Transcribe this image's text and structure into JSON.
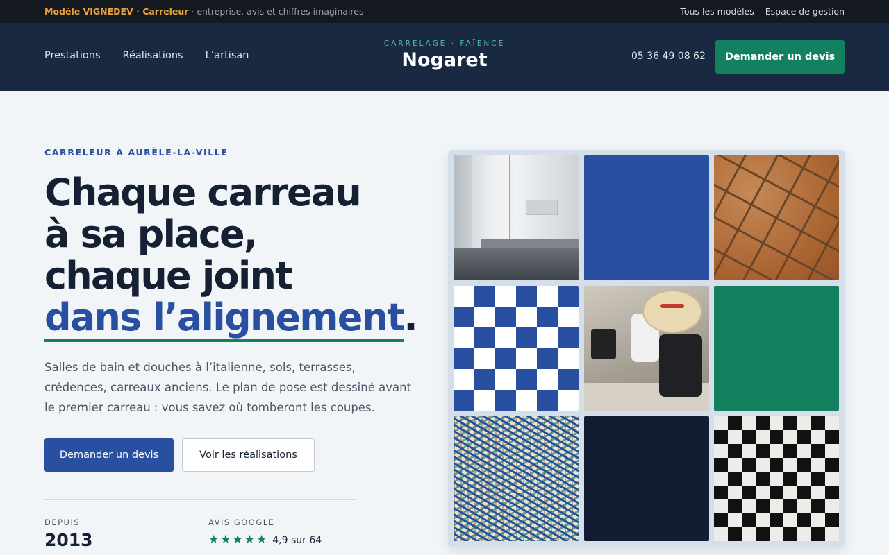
{
  "topstrip": {
    "brand": "Modèle VIGNEDEV · Carreleur",
    "tagline": " · entreprise, avis et chiffres imaginaires",
    "links": [
      "Tous les modèles",
      "Espace de gestion"
    ]
  },
  "header": {
    "nav": [
      "Prestations",
      "Réalisations",
      "L’artisan"
    ],
    "logo_kicker": "CARRELAGE · FAÏENCE",
    "logo_name": "Nogaret",
    "phone": "05 36 49 08 62",
    "cta": "Demander un devis"
  },
  "hero": {
    "eyebrow": "CARRELEUR À AURÈLE-LA-VILLE",
    "title_line1": "Chaque carreau",
    "title_line2": "à sa place,",
    "title_line3": "chaque joint",
    "title_accent": "dans l’alignement",
    "title_end": ".",
    "lead": "Salles de bain et douches à l’italienne, sols, terrasses, crédences, carreaux anciens. Le plan de pose est dessiné avant le premier carreau : vous savez où tomberont les coupes.",
    "btn_primary": "Demander un devis",
    "btn_secondary": "Voir les réalisations"
  },
  "stats": {
    "since_label": "DEPUIS",
    "since_value": "2013",
    "reviews_label": "AVIS GOOGLE",
    "reviews_rating": 4.9,
    "reviews_stars": 5,
    "reviews_text": "4,9 sur 64"
  },
  "colors": {
    "accent_blue": "#2950a0",
    "accent_green": "#13805f",
    "header_bg": "#1a2942",
    "topstrip_bg": "#14181f",
    "brand_orange": "#e9a23b"
  }
}
